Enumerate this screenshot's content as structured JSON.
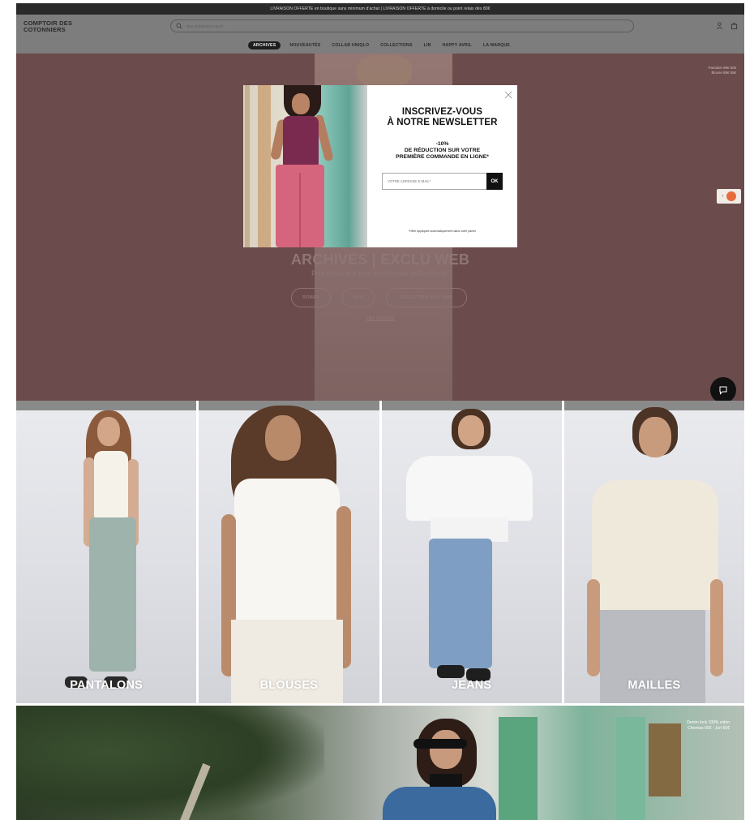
{
  "promo": {
    "text": "LIVRAISON OFFERTE en boutique sans minimum d'achat | LIVRAISON OFFERTE à domicile ou point relais dès 80€"
  },
  "header": {
    "logo_line1": "COMPTOIR DES",
    "logo_line2": "COTONNIERS",
    "search_placeholder": "Que recherchez-vous?",
    "icons": [
      "user-icon",
      "bag-icon"
    ]
  },
  "nav": {
    "items": [
      "ARCHIVES",
      "NOUVEAUTÉS",
      "COLLAB UNIQLO",
      "COLLECTIONS",
      "LIN",
      "HAPPY AVRIL",
      "LA MARQUE"
    ],
    "active_index": 0
  },
  "hero": {
    "price_line1": "Pantalon 89€ 60€",
    "price_line2": "Blouse 85€ 55€",
    "title": "ARCHIVES | EXCLU WEB",
    "subtitle": "Prix doux sur nos anciennes collections*",
    "pills": [
      "ROBES",
      "SAA",
      "SÉLECTION DES -40%"
    ],
    "link": "LES CHUTES"
  },
  "modal": {
    "title_line1": "INSCRIVEZ-VOUS",
    "title_line2": "À NOTRE NEWSLETTER",
    "offer_line1": "-10%",
    "offer_line2": "DE RÉDUCTION SUR VOTRE",
    "offer_line3": "PREMIÈRE COMMANDE EN LIGNE*",
    "email_placeholder": "VOTRE ADRESSE E-MAIL*",
    "submit_label": "OK",
    "note": "*Offre appliquée automatiquement dans votre panier"
  },
  "categories": [
    {
      "label": "PANTALONS"
    },
    {
      "label": "BLOUSES"
    },
    {
      "label": "JEANS"
    },
    {
      "label": "MAILLES"
    }
  ],
  "banner": {
    "price_line1": "Denim look 100% coton",
    "price_line2": "Chemise 65€ - Jort 65€"
  },
  "colors": {
    "hero_bg": "#6b4b4b",
    "header_bg": "#7d7d7d",
    "promo_bg": "#2a2a2a",
    "accent_widget": "#e86c3a"
  }
}
